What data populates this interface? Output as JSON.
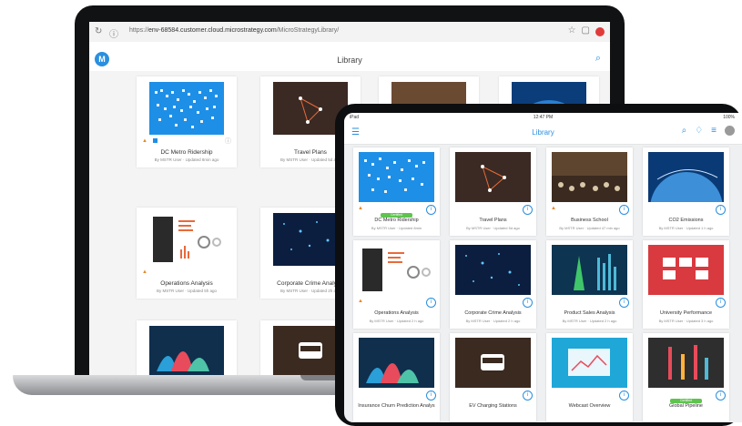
{
  "laptop": {
    "url_prefix": "https://",
    "url_host": "env-68584.customer.cloud.microstrategy.com",
    "url_path": "/MicroStrategyLibrary/",
    "app_logo": "M",
    "app_title": "Library",
    "cards": [
      {
        "title": "DC Metro Ridership",
        "meta": "By MSTR User · Updated 8min ago"
      },
      {
        "title": "Travel Plans",
        "meta": "By MSTR User · Updated 5d ago"
      },
      {
        "title": "",
        "meta": ""
      },
      {
        "title": "",
        "meta": ""
      },
      {
        "title": "Operations Analysis",
        "meta": "By MSTR User · Updated 5h ago"
      },
      {
        "title": "Corporate Crime Analysis",
        "meta": "By MSTR User · Updated 2h ago"
      },
      {
        "title": "",
        "meta": ""
      },
      {
        "title": "",
        "meta": ""
      }
    ]
  },
  "tablet": {
    "status_left": "iPad",
    "time": "12:47 PM",
    "battery": "100%",
    "title": "Library",
    "cards": [
      {
        "title": "DC Metro Ridership",
        "meta": "By MSTR User · Updated 8min",
        "badge": "Certified"
      },
      {
        "title": "Travel Plans",
        "meta": "By MSTR User · Updated 5d ago",
        "badge": ""
      },
      {
        "title": "Business School",
        "meta": "By MSTR User · Updated 47 min ago",
        "badge": ""
      },
      {
        "title": "CO2 Emissions",
        "meta": "By MSTR User · Updated 1 h ago",
        "badge": ""
      },
      {
        "title": "Operations Analysis",
        "meta": "By MSTR User · Updated 2 h ago",
        "badge": ""
      },
      {
        "title": "Corporate Crime Analysis",
        "meta": "By MSTR User · Updated 2 h ago",
        "badge": ""
      },
      {
        "title": "Product Sales Analysis",
        "meta": "By MSTR User · Updated 2 h ago",
        "badge": ""
      },
      {
        "title": "University Performance",
        "meta": "By MSTR User · Updated 3 h ago",
        "badge": ""
      },
      {
        "title": "Insurance Churn Prediction Analys",
        "meta": "",
        "badge": ""
      },
      {
        "title": "EV Charging Stations",
        "meta": "",
        "badge": ""
      },
      {
        "title": "Webcast Overview",
        "meta": "",
        "badge": ""
      },
      {
        "title": "Global Pipeline",
        "meta": "",
        "badge": "Certified"
      }
    ]
  }
}
